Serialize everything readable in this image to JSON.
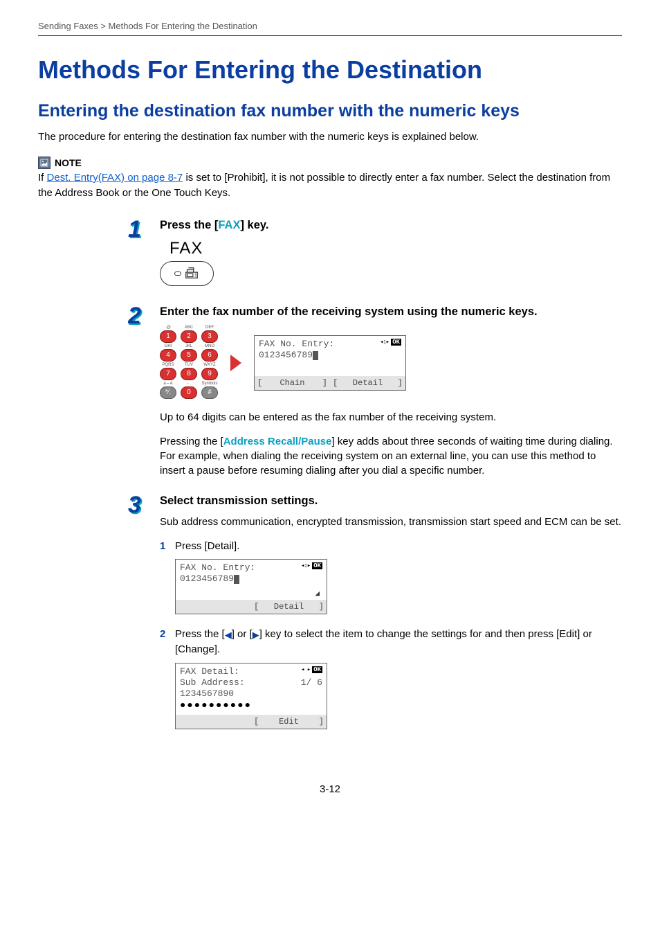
{
  "breadcrumb": "Sending Faxes > Methods For Entering the Destination",
  "h1": "Methods For Entering the Destination",
  "h2": "Entering the destination fax number with the numeric keys",
  "intro": "The procedure for entering the destination fax number with the numeric keys is explained below.",
  "note": {
    "label": "NOTE",
    "pre": "If ",
    "link": "Dest. Entry(FAX) on page 8-7",
    "post": " is set to [Prohibit], it is not possible to directly enter a fax number. Select the destination from the Address Book or the One Touch Keys."
  },
  "step1": {
    "title_pre": "Press the [",
    "title_key": "FAX",
    "title_post": "] key.",
    "fax_label": "FAX"
  },
  "step2": {
    "title": "Enter the fax number of the receiving system using the numeric keys.",
    "keypad": {
      "labels1": [
        ".@",
        "ABC",
        "DEF"
      ],
      "row1": [
        "1",
        "2",
        "3"
      ],
      "labels2": [
        "GHI",
        "JKL",
        "MNO"
      ],
      "row2": [
        "4",
        "5",
        "6"
      ],
      "labels3": [
        "PQRS",
        "TUV",
        "WXYZ"
      ],
      "row3": [
        "7",
        "8",
        "9"
      ],
      "labels4": [
        "a⇔A",
        "- .",
        "Symbols"
      ],
      "row4": [
        "*⁄.",
        "0",
        "#"
      ]
    },
    "lcd": {
      "line1": "FAX No. Entry:",
      "line2": "0123456789",
      "btn1": "Chain",
      "btn2": "Detail"
    },
    "para1": "Up to 64 digits can be entered as the fax number of the receiving system.",
    "para2_pre": "Pressing the [",
    "para2_key": "Address Recall/Pause",
    "para2_post": "] key adds about three seconds of waiting time during dialing. For example, when dialing the receiving system on an external line, you can use this method to insert a pause before resuming dialing after you dial a specific number."
  },
  "step3": {
    "title": "Select transmission settings.",
    "intro": "Sub address communication, encrypted transmission, transmission start speed and ECM can be set.",
    "sub1": {
      "num": "1",
      "text": "Press [Detail]."
    },
    "lcd1": {
      "line1": "FAX No. Entry:",
      "line2": "0123456789",
      "btn1": "",
      "btn2": "Detail"
    },
    "sub2": {
      "num": "2",
      "pre": "Press the [",
      "mid": "] or [",
      "post": "] key to select the item to change the settings for and then press [Edit] or [Change]."
    },
    "lcd2": {
      "line1": "FAX Detail:",
      "line2": "Sub Address:",
      "page": "1/ 6",
      "line3": "1234567890",
      "dots": "●●●●●●●●●●",
      "btn2": "Edit"
    }
  },
  "page_num": "3-12"
}
